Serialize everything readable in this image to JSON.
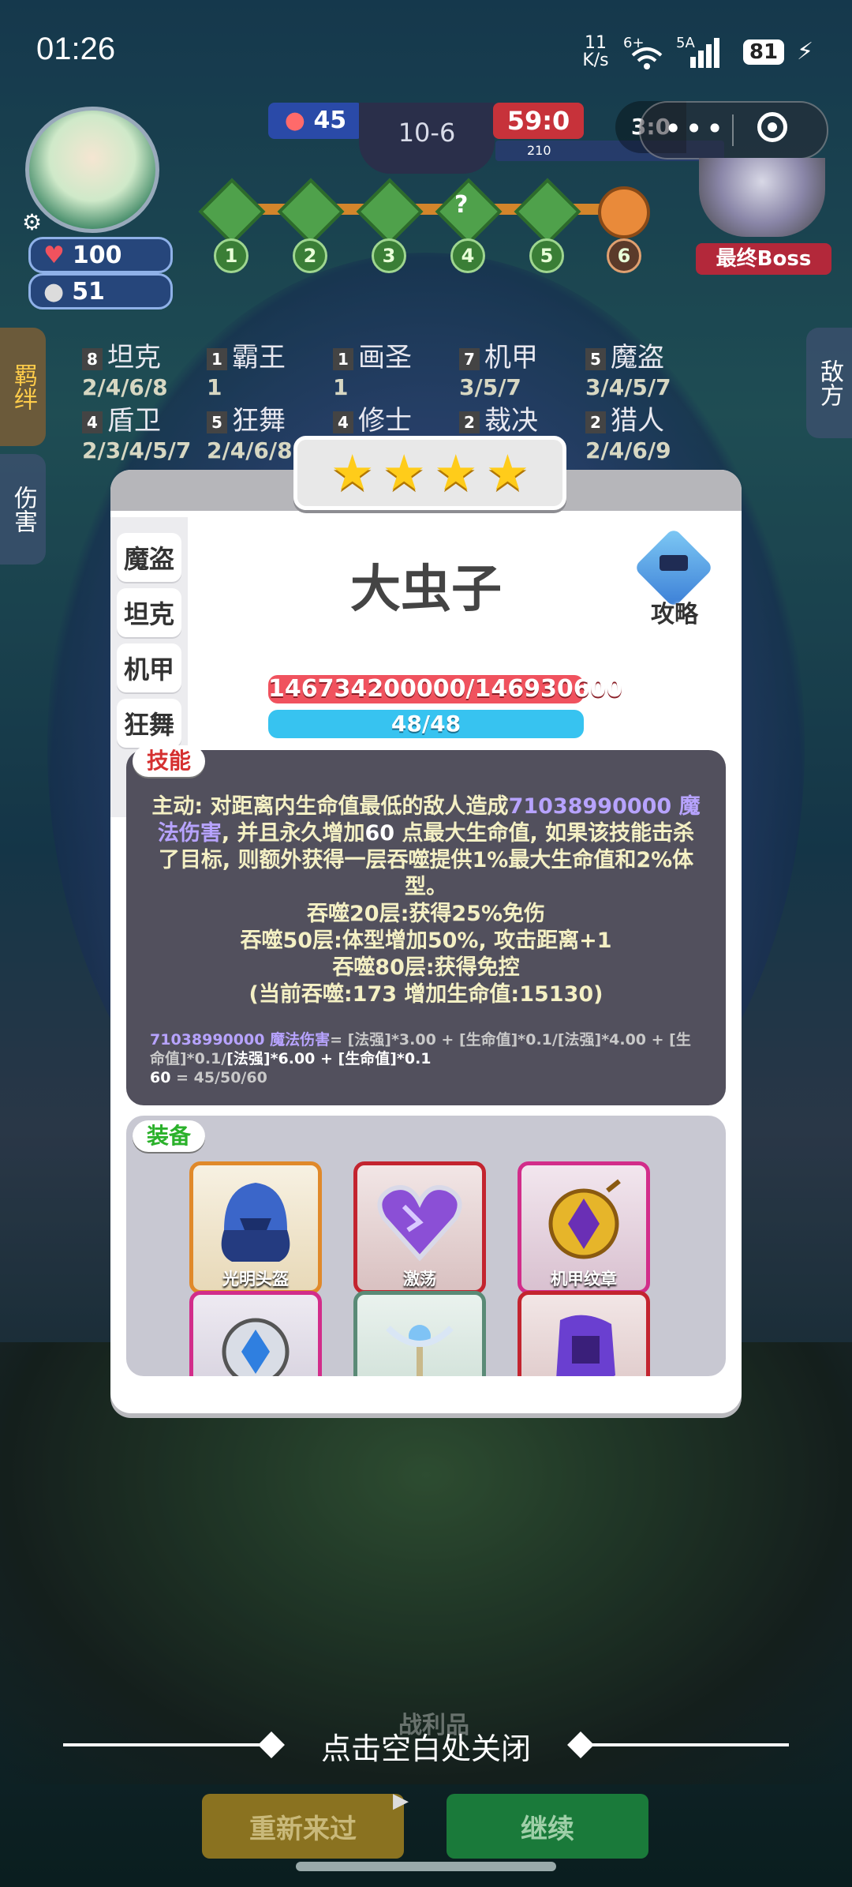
{
  "status": {
    "time": "01:26",
    "net_speed_num": "11",
    "net_speed_unit": "K/s",
    "wifi_label": "6+",
    "signal_label": "5A",
    "battery": "81"
  },
  "hud": {
    "hp_badge": "100",
    "coin_badge": "51",
    "enemy_count": "45",
    "stage": "10-6",
    "score": "59:0",
    "boss_label": "最终Boss",
    "round_nodes": [
      "1",
      "2",
      "3",
      "4",
      "5",
      "6"
    ],
    "mystery_mark": "?",
    "item_count": "210",
    "timer_partial": "3:0"
  },
  "synergies": [
    {
      "count": "8",
      "name": "坦克",
      "tiers": "2/4/6/8"
    },
    {
      "count": "1",
      "name": "霸王",
      "tiers": "1"
    },
    {
      "count": "1",
      "name": "画圣",
      "tiers": "1"
    },
    {
      "count": "7",
      "name": "机甲",
      "tiers": "3/5/7"
    },
    {
      "count": "5",
      "name": "魔盗",
      "tiers": "3/4/5/7"
    },
    {
      "count": "4",
      "name": "盾卫",
      "tiers": "2/3/4/5/7"
    },
    {
      "count": "5",
      "name": "狂舞",
      "tiers": "2/4/6/8"
    },
    {
      "count": "4",
      "name": "修士",
      "tiers": ""
    },
    {
      "count": "2",
      "name": "裁决",
      "tiers": ""
    },
    {
      "count": "2",
      "name": "猎人",
      "tiers": "2/4/6/9"
    }
  ],
  "side_tabs": {
    "left_top": "羁绊",
    "left_bottom": "伤害",
    "right": "敌方"
  },
  "hero": {
    "name": "大虫子",
    "guide_label": "攻略",
    "classes": [
      "魔盗",
      "坦克",
      "机甲",
      "狂舞"
    ],
    "hp": "146734200000/146930600",
    "mana": "48/48",
    "stars": 4
  },
  "skill": {
    "tag": "技能",
    "line1_pre": "主动: 对距离内生命值最低的敌人造成",
    "line1_value": "71038990000",
    "line1_type": "魔法伤害",
    "line1_mid": ", 并且永久增加",
    "line1_hp": "60",
    "line1_post": "点最大生命值, 如果该技能击杀了目标, 则额外获得一层吞噬提供1%最大生命值和2%体型。",
    "line2": "吞噬20层:获得25%免伤",
    "line3": "吞噬50层:体型增加50%, 攻击距离+1",
    "line4": "吞噬80层:获得免控",
    "line5": "(当前吞噬:173 增加生命值:15130)",
    "formula1_value": "71038990000",
    "formula1_type": "魔法伤害",
    "formula1_expr": "= [法强]*3.00 + [生命值]*0.1/[法强]*4.00 + [生命值]*0.1/",
    "formula1_tail": "[法强]*6.00 + [生命值]*0.1",
    "formula2": "60",
    "formula2_expr": " = 45/50/60"
  },
  "equipment": {
    "tag": "装备",
    "items": [
      {
        "name": "光明头盔"
      },
      {
        "name": "激荡"
      },
      {
        "name": "机甲纹章"
      },
      {
        "name": ""
      },
      {
        "name": ""
      },
      {
        "name": ""
      }
    ]
  },
  "footer": {
    "close_hint": "点击空白处关闭",
    "loot_label": "战利品",
    "retry": "重新来过",
    "continue": "继续"
  },
  "colors": {
    "hp_bar": "#f0525e",
    "mana_bar": "#37c3f0",
    "skill_panel": "#52505d",
    "retry_btn": "#b8941a",
    "continue_btn": "#1f9a46"
  }
}
